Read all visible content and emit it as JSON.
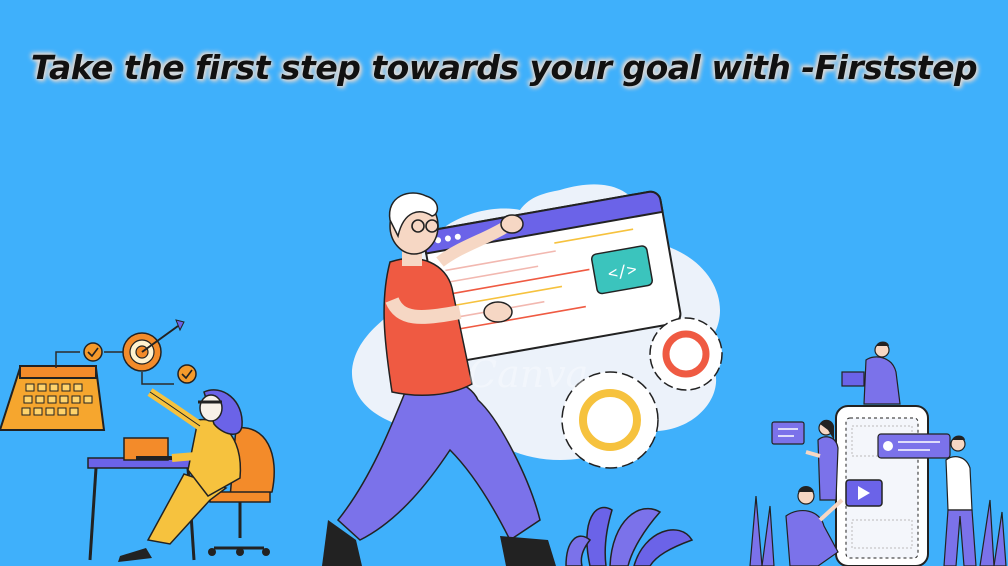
{
  "headline": "Take the first step towards your goal with -Firststep",
  "watermark": "Canva",
  "colors": {
    "background": "#3fb0fb",
    "accent_purple": "#6b63e8",
    "accent_orange": "#f5892a",
    "accent_yellow": "#f6c23e",
    "accent_red": "#ef5a42"
  },
  "illustrations": [
    "person-with-code-window",
    "woman-at-desk-with-calendar-and-target",
    "team-around-phone-screen"
  ]
}
